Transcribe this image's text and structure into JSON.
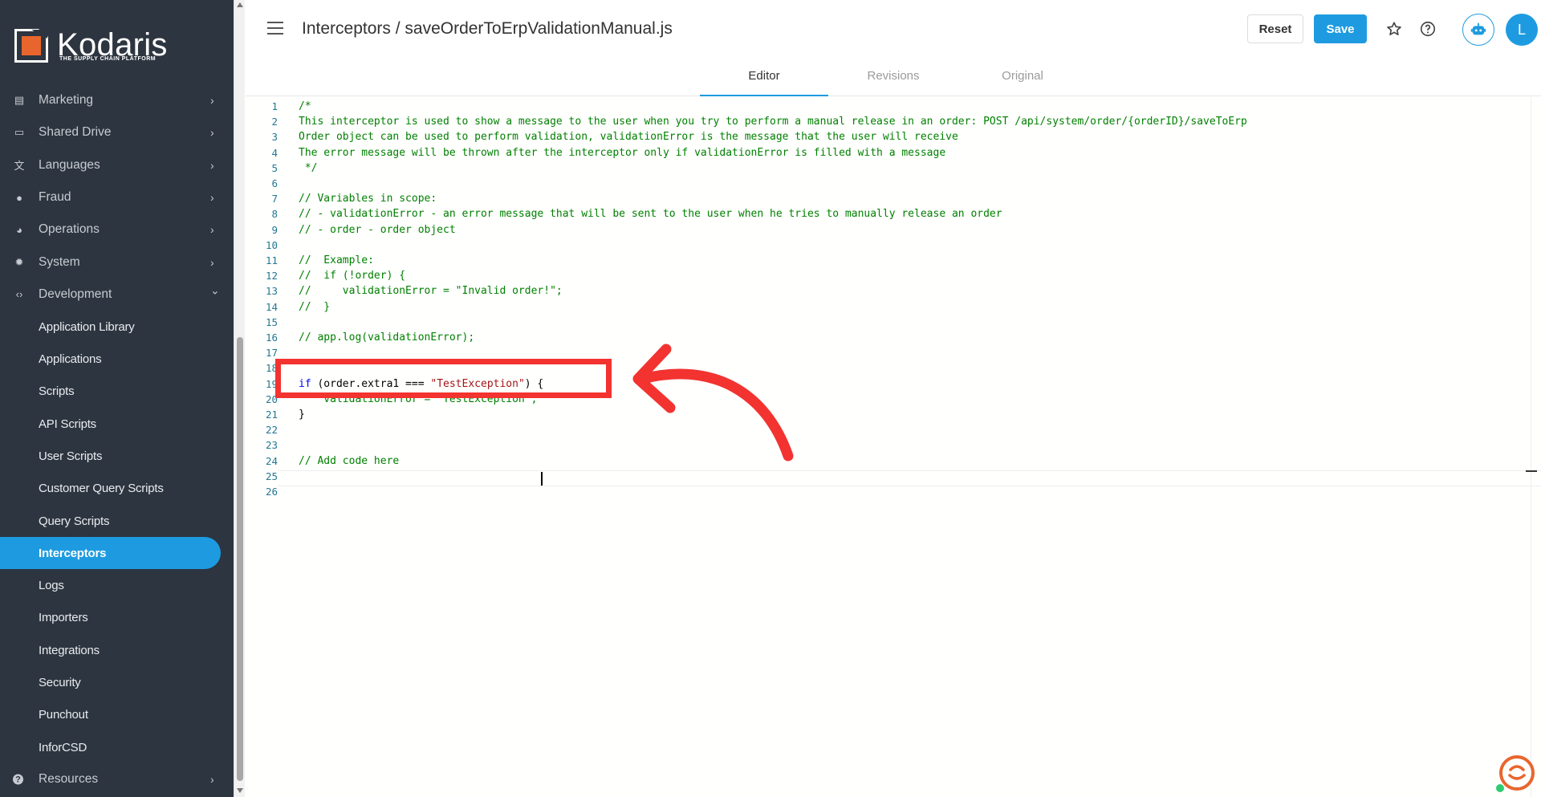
{
  "brand": {
    "name": "Kodaris",
    "tagline": "THE SUPPLY CHAIN PLATFORM",
    "accent_color": "#1e9be0",
    "logo_color": "#e8662d"
  },
  "sidebar": {
    "items": [
      {
        "label": "Marketing",
        "icon": "megaphone-icon"
      },
      {
        "label": "Shared Drive",
        "icon": "folder-icon"
      },
      {
        "label": "Languages",
        "icon": "translate-icon"
      },
      {
        "label": "Fraud",
        "icon": "alert-icon"
      },
      {
        "label": "Operations",
        "icon": "operations-icon"
      },
      {
        "label": "System",
        "icon": "gear-icon"
      },
      {
        "label": "Development",
        "icon": "code-icon"
      }
    ],
    "sub_items": [
      "Application Library",
      "Applications",
      "Scripts",
      "API Scripts",
      "User Scripts",
      "Customer Query Scripts",
      "Query Scripts",
      "Interceptors",
      "Logs",
      "Importers",
      "Integrations",
      "Security",
      "Punchout",
      "InforCSD"
    ],
    "active_item": "Interceptors",
    "bottom_item": {
      "label": "Resources",
      "icon": "help-circle-icon"
    }
  },
  "header": {
    "title": "Interceptors / saveOrderToErpValidationManual.js",
    "reset_label": "Reset",
    "save_label": "Save",
    "avatar_initial": "L"
  },
  "tabs": [
    "Editor",
    "Revisions",
    "Original"
  ],
  "active_tab": "Editor",
  "editor": {
    "lines": [
      {
        "n": "1",
        "text": "/*"
      },
      {
        "n": "2",
        "text": "This interceptor is used to show a message to the user when you try to perform a manual release in an order: POST /api/system/order/{orderID}/saveToErp"
      },
      {
        "n": "3",
        "text": "Order object can be used to perform validation, validationError is the message that the user will receive"
      },
      {
        "n": "4",
        "text": "The error message will be thrown after the interceptor only if validationError is filled with a message"
      },
      {
        "n": "5",
        "text": " */"
      },
      {
        "n": "6",
        "text": ""
      },
      {
        "n": "7",
        "text": "// Variables in scope:"
      },
      {
        "n": "8",
        "text": "// - validationError - an error message that will be sent to the user when he tries to manually release an order"
      },
      {
        "n": "9",
        "text": "// - order - order object"
      },
      {
        "n": "10",
        "text": ""
      },
      {
        "n": "11",
        "text": "//  Example:"
      },
      {
        "n": "12",
        "text": "//  if (!order) {"
      },
      {
        "n": "13",
        "text": "//     validationError = \"Invalid order!\";"
      },
      {
        "n": "14",
        "text": "//  }"
      },
      {
        "n": "15",
        "text": ""
      },
      {
        "n": "16",
        "text": "// app.log(validationError);"
      },
      {
        "n": "17",
        "text": ""
      },
      {
        "n": "18",
        "text": ""
      },
      {
        "n": "19",
        "kw": "if",
        "mid": " (order.extra1 === ",
        "str": "\"TestException\"",
        "end": ") {"
      },
      {
        "n": "20",
        "text": "    validationError = \"TestException\";"
      },
      {
        "n": "21",
        "plain": "}"
      },
      {
        "n": "22",
        "text": ""
      },
      {
        "n": "23",
        "text": ""
      },
      {
        "n": "24",
        "text": "// Add code here"
      },
      {
        "n": "25",
        "text": ""
      },
      {
        "n": "26",
        "text": ""
      }
    ]
  },
  "annotation_color": "#f23330"
}
